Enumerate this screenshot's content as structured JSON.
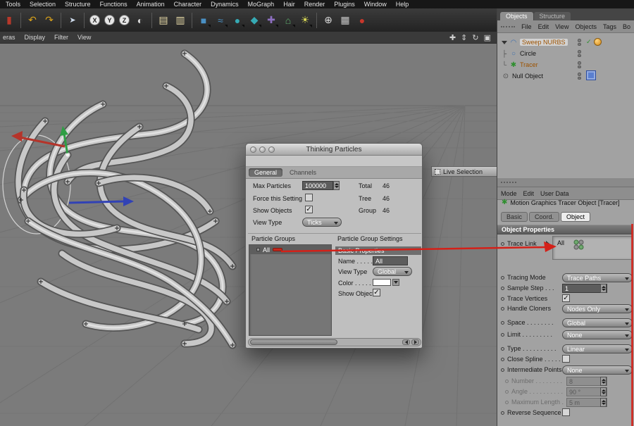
{
  "menubar": {
    "items": [
      "Tools",
      "Selection",
      "Structure",
      "Functions",
      "Animation",
      "Character",
      "Dynamics",
      "MoGraph",
      "Hair",
      "Render",
      "Plugins",
      "Window",
      "Help"
    ]
  },
  "toolbar": {
    "icons": [
      {
        "name": "brand-icon",
        "glyph": "▮"
      },
      {
        "name": "undo-icon",
        "glyph": "↶"
      },
      {
        "name": "redo-icon",
        "glyph": "↷"
      },
      {
        "name": "selection-arrow-icon",
        "glyph": "➤"
      },
      {
        "name": "axis-x-lock-icon",
        "glyph": "X"
      },
      {
        "name": "axis-y-lock-icon",
        "glyph": "Y"
      },
      {
        "name": "axis-z-lock-icon",
        "glyph": "Z"
      },
      {
        "name": "coordinate-system-icon",
        "glyph": "◐"
      },
      {
        "name": "new-scene-icon",
        "glyph": "▤"
      },
      {
        "name": "render-settings-icon",
        "glyph": "▥"
      },
      {
        "name": "primitive-cube-icon",
        "glyph": "■"
      },
      {
        "name": "spline-icon",
        "glyph": "≈"
      },
      {
        "name": "nurbs-icon",
        "glyph": "●"
      },
      {
        "name": "modeling-icon",
        "glyph": "◆"
      },
      {
        "name": "deformer-icon",
        "glyph": "✚"
      },
      {
        "name": "environment-icon",
        "glyph": "⌂"
      },
      {
        "name": "light-icon",
        "glyph": "☀"
      },
      {
        "name": "snap-icon",
        "glyph": "⊕"
      },
      {
        "name": "spreadsheet-icon",
        "glyph": "▦"
      },
      {
        "name": "record-icon",
        "glyph": "●"
      }
    ]
  },
  "viewport": {
    "menu_items": [
      "eras",
      "Display",
      "Filter",
      "View"
    ],
    "nav_icons": [
      {
        "name": "pan-view-icon",
        "glyph": "✚"
      },
      {
        "name": "zoom-view-icon",
        "glyph": "⇕"
      },
      {
        "name": "rotate-view-icon",
        "glyph": "↻"
      },
      {
        "name": "toggle-view-icon",
        "glyph": "▣"
      }
    ],
    "live_selection_label": "Live Selection"
  },
  "dialog": {
    "title": "Thinking Particles",
    "tab_general": "General",
    "tab_channels": "Channels",
    "max_particles_label": "Max Particles",
    "max_particles_value": "100000",
    "total_label": "Total",
    "total_value": "46",
    "force_setting_label": "Force this Setting",
    "force_setting_state": "",
    "tree_label": "Tree",
    "tree_value": "46",
    "show_objects_label": "Show Objects",
    "show_objects_state": "✓",
    "group_label": "Group",
    "group_value": "46",
    "view_type_label": "View Type",
    "view_type_value": "Ticks",
    "particle_groups_header": "Particle Groups",
    "group_item_label": "All",
    "settings_header": "Particle Group Settings",
    "basic_properties_header": "Basic Properties",
    "name_label": "Name . . . . .",
    "name_value": "All",
    "group_view_type_label": "View Type",
    "group_view_type_value": "Global",
    "color_label": "Color . . . . .",
    "show_object_label": "Show Object",
    "show_object_state": "✓"
  },
  "objects_panel": {
    "tab_objects": "Objects",
    "tab_structure": "Structure",
    "menu_items": [
      "File",
      "Edit",
      "View",
      "Objects",
      "Tags",
      "Bo"
    ],
    "enable_check_glyph": "✓",
    "tree": [
      {
        "label": "Sweep NURBS",
        "icon": "◠"
      },
      {
        "label": "Circle",
        "icon": "○",
        "connector": "├"
      },
      {
        "label": "Tracer",
        "icon": "✱",
        "connector": "└"
      },
      {
        "label": "Null Object",
        "icon": "⊙"
      }
    ]
  },
  "attributes_panel": {
    "menu_items": [
      "Mode",
      "Edit",
      "User Data"
    ],
    "object_icon": "✱",
    "object_title": "Motion Graphics Tracer Object [Tracer]",
    "tabs": [
      "Basic",
      "Coord.",
      "Object"
    ],
    "section_header": "Object Properties",
    "trace_link_label": "Trace Link",
    "trace_link_value": "All",
    "rows": [
      {
        "label": "Tracing Mode",
        "value": "Trace Paths"
      },
      {
        "label": "Sample Step . . .",
        "value": "1"
      },
      {
        "label": "Trace Vertices",
        "value": "✓"
      },
      {
        "label": "Handle Cloners",
        "value": "Nodes Only"
      },
      {
        "label": "Space . . . . . . . .",
        "value": "Global"
      },
      {
        "label": "Limit . . . . . . . . .",
        "value": "None"
      },
      {
        "label": "Type . . . . . . . . . .",
        "value": "Linear"
      },
      {
        "label": "Close Spline . . . . .",
        "value": ""
      },
      {
        "label": "Intermediate Points",
        "value": "None"
      },
      {
        "label": "Number . . . . . . . .",
        "value": "8"
      },
      {
        "label": "Angle . . . . . . . . . .",
        "value": "90 °"
      },
      {
        "label": "Maximum Length .",
        "value": "5 m"
      },
      {
        "label": "Reverse Sequence .",
        "value": ""
      }
    ]
  },
  "colors": {
    "annotation_red": "#d42018",
    "group_swatch_red": "#c4281c",
    "axis_x": "#b5342a",
    "axis_y": "#2f9e44",
    "axis_z": "#3142b5",
    "viewport_bg": "#7b7b7b"
  }
}
